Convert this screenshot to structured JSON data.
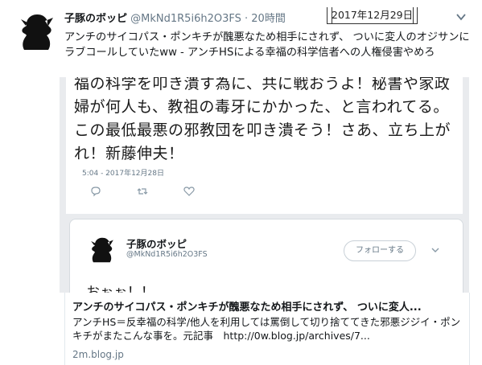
{
  "tweet": {
    "author_name": "子豚のボッピ",
    "author_handle": "@MkNd1R5i6h2O3FS",
    "separator": "·",
    "time": "20時間",
    "text": "アンチのサイコパス・ポンキチが醜悪なため相手にされず、 ついに変人のオジサンにラブコールしていたww - アンチHSによる幸福の科学信者への人権侵害やめろ"
  },
  "date_stamp": "2017年12月29日",
  "screenshot": {
    "body_text": "福の科学を叩き潰す為に、共に戦おうよ！秘書や家政婦が何人も、教祖の毒牙にかかった、と言われてる。この最低最悪の邪教団を叩き潰そう！さあ、立ち上がれ！新藤伸夫！",
    "timestamp": "5:04 - 2017年12月28日",
    "card": {
      "name": "子豚のボッピ",
      "handle": "@MkNd1R5i6h2O3FS",
      "follow_label": "フォローする",
      "partial_text": "おぉぉ！！"
    }
  },
  "link_card": {
    "title": "アンチのサイコパス・ポンキチが醜悪なため相手にされず、 ついに変人...",
    "description": "アンチHS＝反幸福の科学/他人を利用しては罵倒して切り捨ててきた邪悪ジジイ・ポンキチがまたこんな事を。元記事　http://0w.blog.jp/archives/7...",
    "domain": "2m.blog.jp"
  },
  "icons": {
    "avatar": "silhouette-avatar-icon",
    "more": "chevron-down-icon",
    "reply": "reply-icon",
    "retweet": "retweet-icon",
    "like": "heart-icon"
  }
}
